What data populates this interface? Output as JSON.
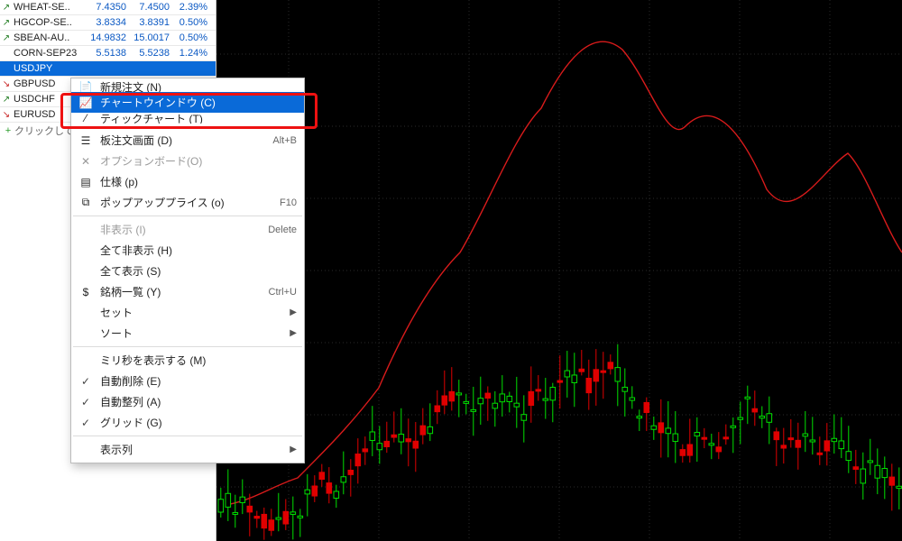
{
  "watchlist": {
    "rows": [
      {
        "dir": "up",
        "sym": "WHEAT-SE..",
        "bid": "7.4350",
        "ask": "7.4500",
        "chg": "2.39%"
      },
      {
        "dir": "up",
        "sym": "HGCOP-SE..",
        "bid": "3.8334",
        "ask": "3.8391",
        "chg": "0.50%"
      },
      {
        "dir": "up",
        "sym": "SBEAN-AU..",
        "bid": "14.9832",
        "ask": "15.0017",
        "chg": "0.50%"
      },
      {
        "dir": "",
        "sym": "CORN-SEP23",
        "bid": "5.5138",
        "ask": "5.5238",
        "chg": "1.24%"
      },
      {
        "dir": "",
        "sym": "USDJPY",
        "bid": "",
        "ask": "",
        "chg": "",
        "sel": true
      },
      {
        "dir": "down",
        "sym": "GBPUSD",
        "bid": "",
        "ask": "",
        "chg": ""
      },
      {
        "dir": "up",
        "sym": "USDCHF",
        "bid": "",
        "ask": "",
        "chg": ""
      },
      {
        "dir": "down",
        "sym": "EURUSD",
        "bid": "",
        "ask": "",
        "chg": ""
      }
    ],
    "add_label": "クリックして"
  },
  "menu": {
    "items": [
      {
        "icon": "doc",
        "label": "新規注文 (N)",
        "truncated": true
      },
      {
        "icon": "chart",
        "label": "チャートウインドウ (C)",
        "hl": true
      },
      {
        "icon": "tick",
        "label": "ティックチャート (T)",
        "truncated": true
      },
      {
        "sep": true
      },
      {
        "icon": "board",
        "label": "板注文画面 (D)",
        "shortcut": "Alt+B"
      },
      {
        "icon": "opt",
        "label": "オプションボード(O)",
        "dis": true
      },
      {
        "icon": "spec",
        "label": "仕様 (p)"
      },
      {
        "icon": "popup",
        "label": "ポップアッププライス (o)",
        "shortcut": "F10"
      },
      {
        "sep": true
      },
      {
        "label": "非表示 (I)",
        "dis": true,
        "shortcut": "Delete"
      },
      {
        "label": "全て非表示 (H)"
      },
      {
        "label": "全て表示 (S)"
      },
      {
        "icon": "list",
        "label": "銘柄一覧 (Y)",
        "shortcut": "Ctrl+U"
      },
      {
        "label": "セット",
        "sub": true
      },
      {
        "label": "ソート",
        "sub": true
      },
      {
        "sep": true
      },
      {
        "label": "ミリ秒を表示する (M)"
      },
      {
        "chk": true,
        "label": "自動削除 (E)"
      },
      {
        "chk": true,
        "label": "自動整列 (A)"
      },
      {
        "chk": true,
        "label": "グリッド (G)"
      },
      {
        "sep": true
      },
      {
        "label": "表示列",
        "sub": true
      }
    ]
  }
}
